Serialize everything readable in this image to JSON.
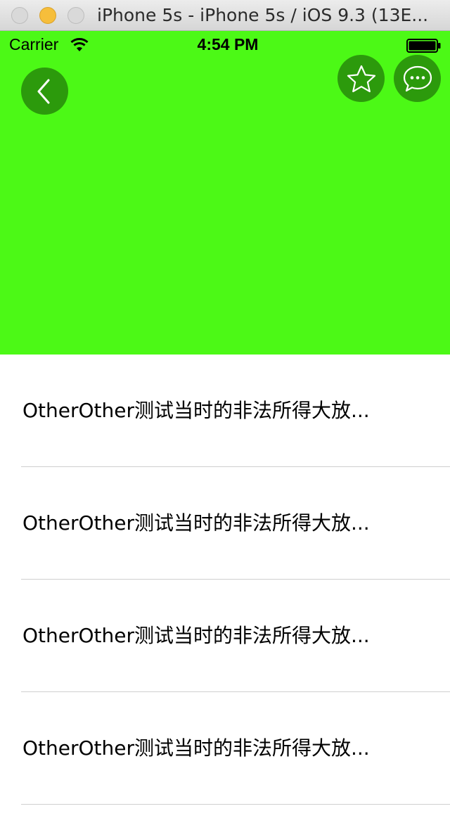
{
  "window": {
    "title": "iPhone 5s - iPhone 5s / iOS 9.3 (13E..."
  },
  "status_bar": {
    "carrier": "Carrier",
    "time": "4:54 PM"
  },
  "header": {
    "background_color": "#4cf916",
    "button_color": "#2c9a0c",
    "buttons": [
      "back-icon",
      "star-icon",
      "comment-icon"
    ]
  },
  "list": {
    "items": [
      {
        "text": "OtherOther测试当时的非法所得大放..."
      },
      {
        "text": "OtherOther测试当时的非法所得大放..."
      },
      {
        "text": "OtherOther测试当时的非法所得大放..."
      },
      {
        "text": "OtherOther测试当时的非法所得大放..."
      }
    ]
  }
}
